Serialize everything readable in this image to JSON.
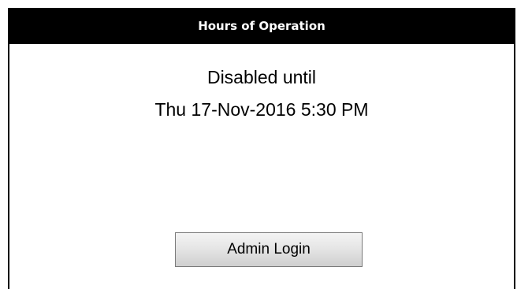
{
  "header": {
    "title": "Hours of Operation"
  },
  "status": {
    "line1": "Disabled until",
    "line2": "Thu 17-Nov-2016 5:30 PM"
  },
  "actions": {
    "admin_login_label": "Admin Login"
  }
}
